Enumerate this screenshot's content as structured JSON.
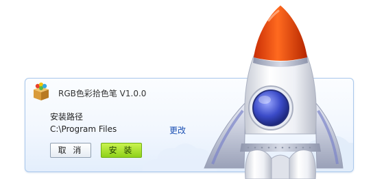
{
  "dialog": {
    "title": "RGB色彩拾色笔 V1.0.0",
    "path_label": "安装路径",
    "path_value": "C:\\Program Files",
    "change_link": "更改",
    "cancel_label": "取 消",
    "install_label": "安 装"
  },
  "icons": {
    "app": "app-box-icon",
    "rocket": "rocket-illustration"
  },
  "colors": {
    "install_button": "#9ad81e",
    "link": "#1a4fb3",
    "panel_border": "#aac8ec",
    "rocket_nose": "#e8410f"
  }
}
